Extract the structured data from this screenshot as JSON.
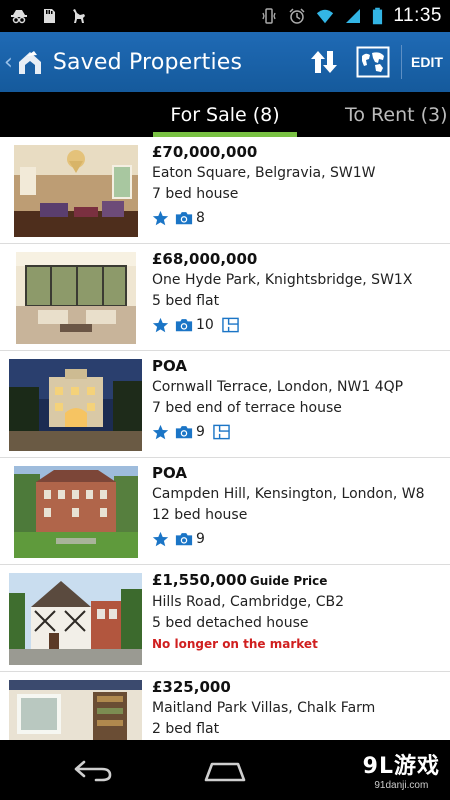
{
  "status_bar": {
    "time": "11:35",
    "left_icons": [
      "incognito-icon",
      "sd-card-icon",
      "cat-icon"
    ],
    "right_icons": [
      "vibrate-icon",
      "alarm-icon",
      "wifi-icon",
      "signal-icon",
      "battery-icon"
    ]
  },
  "action_bar": {
    "title": "Saved Properties",
    "edit_label": "EDIT",
    "icons": [
      "back-chevron-icon",
      "app-logo-icon",
      "sort-icon",
      "map-icon"
    ]
  },
  "tabs": [
    {
      "label": "For Sale (8)",
      "selected": true
    },
    {
      "label": "To Rent (3)",
      "selected": false
    }
  ],
  "listings": [
    {
      "price": "£70,000,000",
      "address": "Eaton Square, Belgravia, SW1W",
      "type": "7 bed house",
      "photos": "8",
      "floorplan": false
    },
    {
      "price": "£68,000,000",
      "address": "One Hyde Park,  Knightsbridge, SW1X",
      "type": "5 bed flat",
      "photos": "10",
      "floorplan": true
    },
    {
      "price": "POA",
      "address": "Cornwall Terrace, London, NW1 4QP",
      "type": "7 bed end of terrace house",
      "photos": "9",
      "floorplan": true
    },
    {
      "price": "POA",
      "address": "Campden Hill, Kensington, London, W8",
      "type": "12 bed house",
      "photos": "9",
      "floorplan": false
    },
    {
      "price": "£1,550,000",
      "price_qualifier": "Guide Price",
      "address": "Hills Road, Cambridge, CB2",
      "type": "5 bed detached house",
      "status": "No longer on the market"
    },
    {
      "price": "£325,000",
      "address": "Maitland Park Villas, Chalk Farm",
      "type": "2 bed flat"
    }
  ],
  "colors": {
    "action_bar": "#1a5fa3",
    "tab_indicator": "#79c143",
    "icon_blue": "#1b75c6",
    "status_red": "#d01f1f"
  },
  "nav_bar": {
    "icons": [
      "back-icon",
      "home-icon"
    ],
    "watermark_main": "9L游戏",
    "watermark_sub": "91danji.com"
  }
}
